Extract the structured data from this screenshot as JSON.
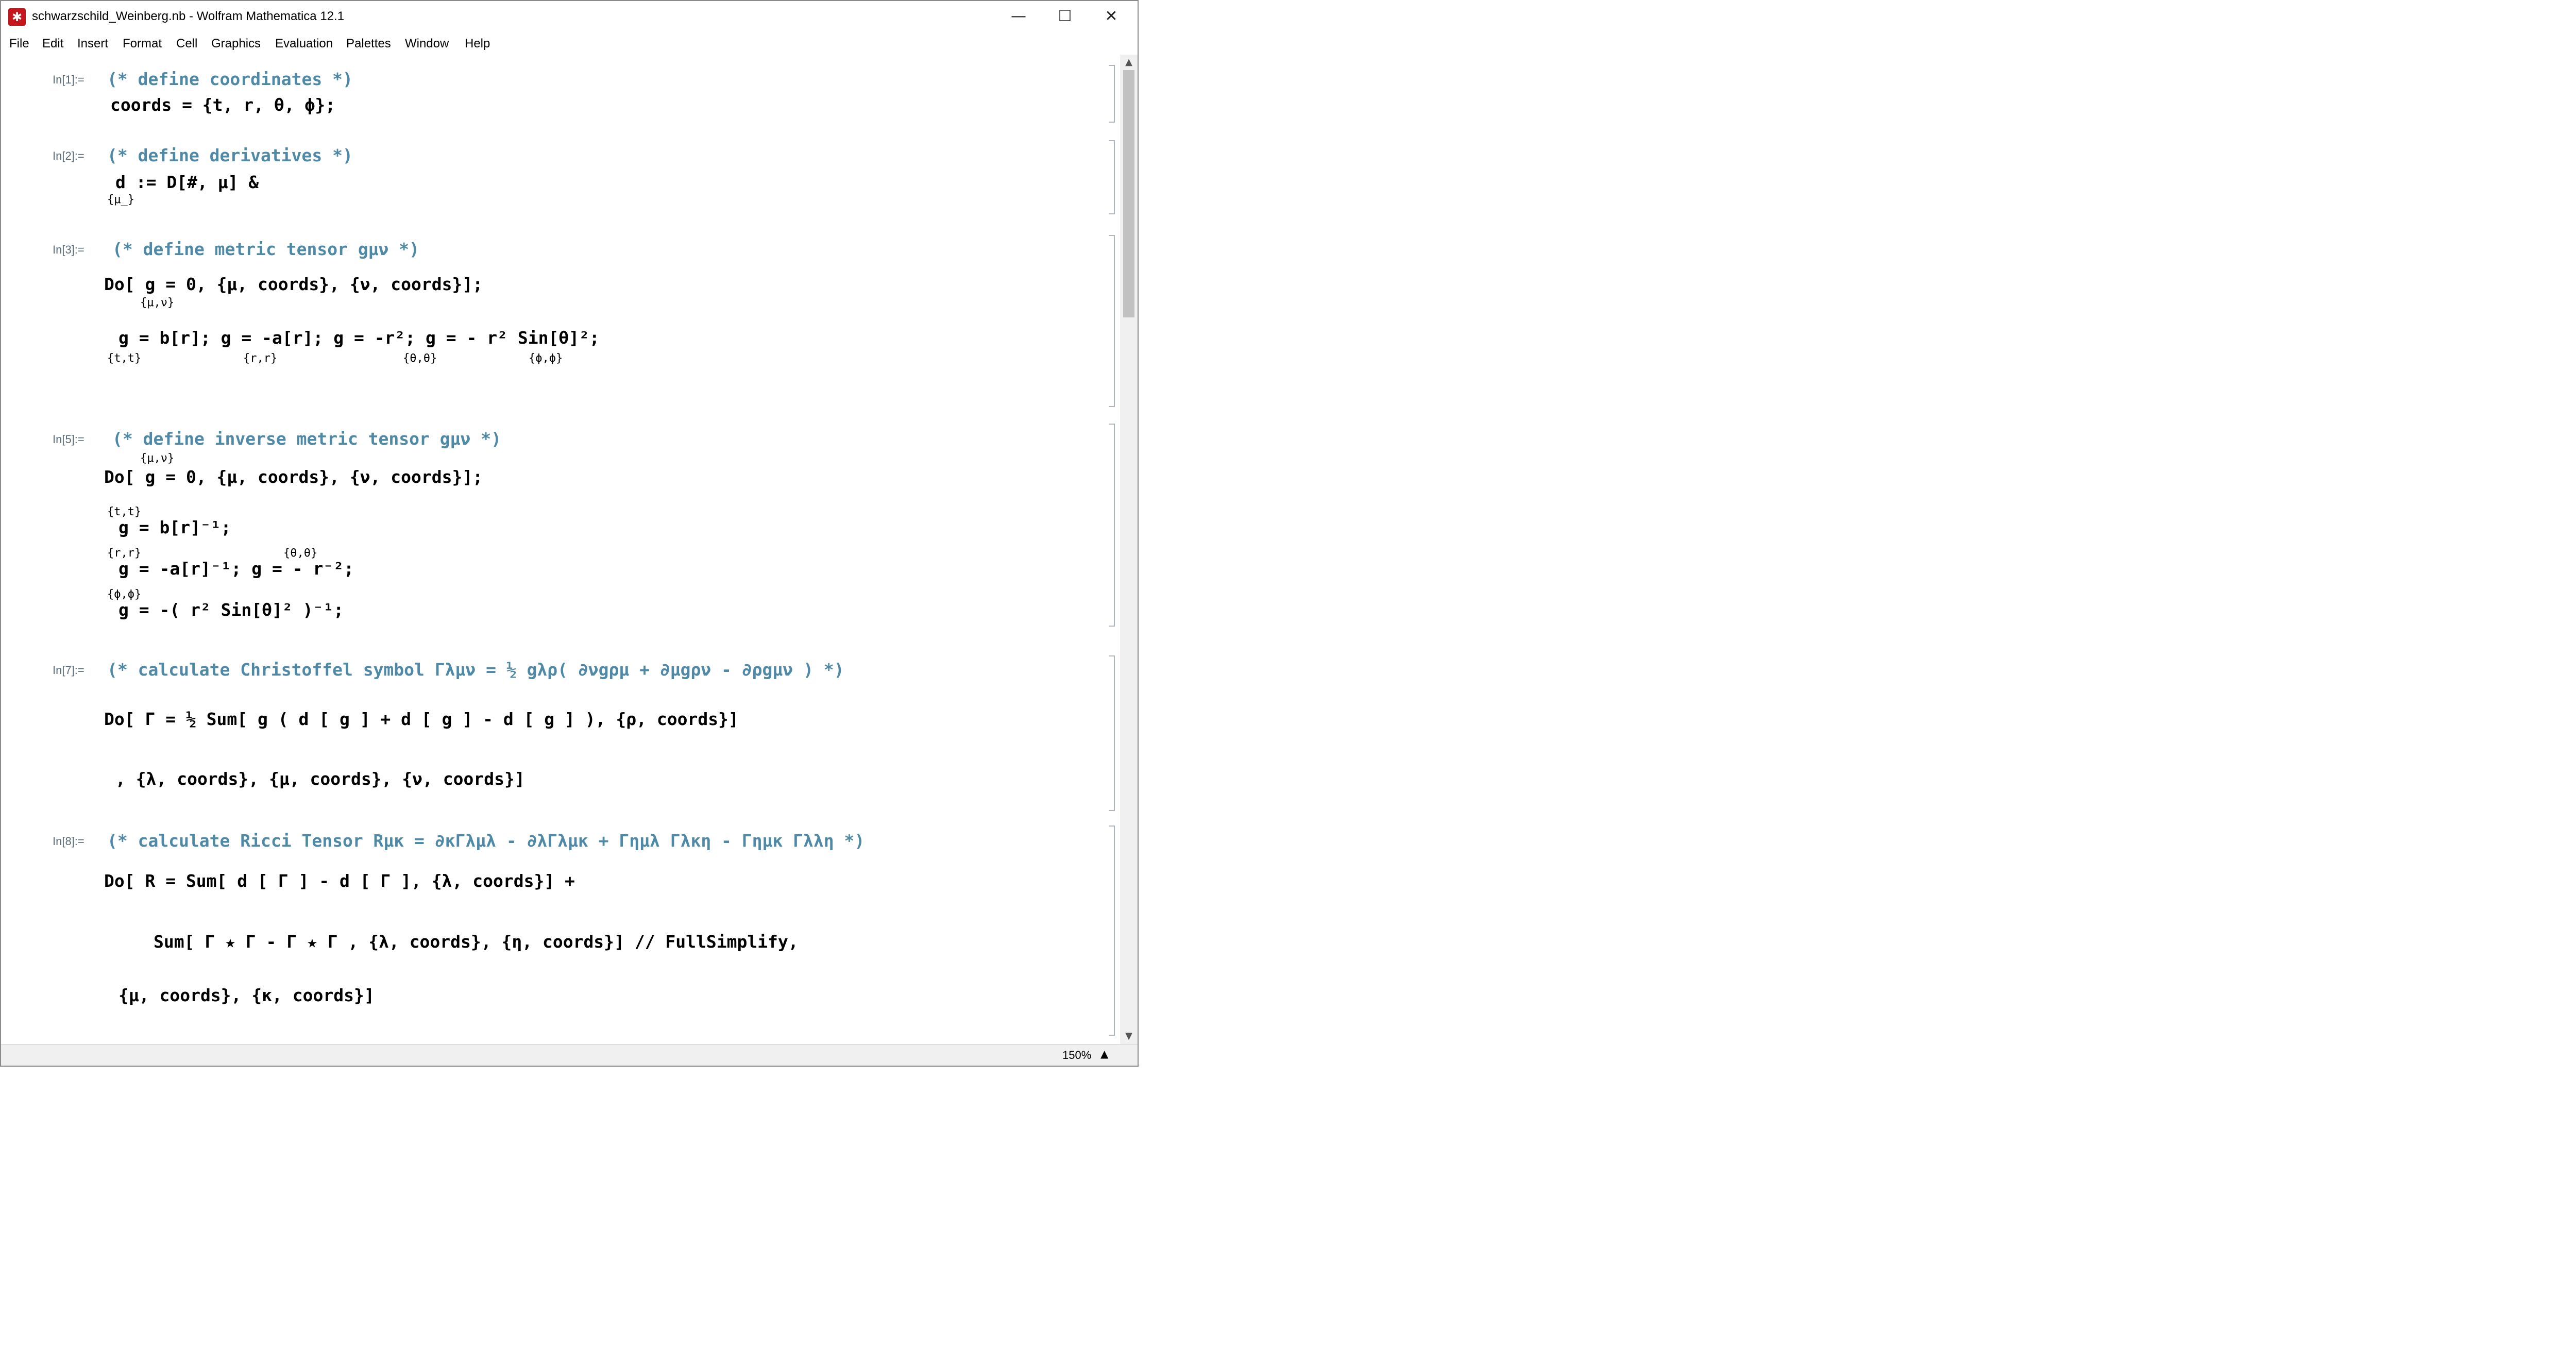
{
  "window": {
    "title": "schwarzschild_Weinberg.nb - Wolfram Mathematica 12.1",
    "app_icon": "mathematica-icon",
    "minimize": "—",
    "maximize": "☐",
    "close": "✕"
  },
  "menu": [
    "File",
    "Edit",
    "Insert",
    "Format",
    "Cell",
    "Graphics",
    "Evaluation",
    "Palettes",
    "Window",
    "Help"
  ],
  "cells": [
    {
      "label": "In[1]:=",
      "comment": "(* define coordinates *)",
      "lines": [
        "coords = {t, r, θ, ϕ};"
      ]
    },
    {
      "label": "In[2]:=",
      "comment": "(* define derivatives *)",
      "lines": [
        "d   := D[#, μ] &"
      ],
      "subs": [
        "{μ_}"
      ]
    },
    {
      "label": "In[3]:=",
      "comment": "(* define metric tensor gμν  *)",
      "lines": [
        "Do[ g    = 0, {μ, coords}, {ν, coords}];",
        "g      = b[r];  g      = -a[r];  g      = -r²;  g      = - r² Sin[θ]²;"
      ],
      "subs": [
        "{μ,ν}",
        "{t,t}",
        "{r,r}",
        "{θ,θ}",
        "{ϕ,ϕ}"
      ]
    },
    {
      "label": "In[5]:=",
      "comment": "(* define inverse metric tensor gμν  *)",
      "lines": [
        "Do[ g    = 0, {μ, coords}, {ν, coords}];",
        "g  = b[r]⁻¹;",
        "g   = -a[r]⁻¹;   g   = - r⁻²;",
        "g  = -( r² Sin[θ]² )⁻¹;"
      ],
      "sups": [
        "{μ,ν}",
        "{t,t}",
        "{r,r}",
        "{θ,θ}",
        "{ϕ,ϕ}"
      ]
    },
    {
      "label": "In[7]:=",
      "comment": "(* calculate Christoffel symbol  Γλμν =  ½  gλρ( ∂νgρμ + ∂μgρν - ∂ρgμν )  *)",
      "lines": [
        "Do[ Γ   =  ½ Sum[ g  ( d  [ g   ] + d  [ g   ] - d  [ g   ] ), {ρ, coords}]",
        ", {λ, coords}, {μ, coords}, {ν, coords}]"
      ],
      "frac_num": "1",
      "frac_den": "2"
    },
    {
      "label": "In[8]:=",
      "comment": "(* calculate Ricci Tensor  Rμκ = ∂κΓλμλ - ∂λΓλμκ  + Γημλ Γλκη -  Γημκ Γλλη  *)",
      "lines": [
        "Do[ R    = Sum[ d  [ Γ    ] - d  [ Γ    ], {λ, coords}] +",
        "Sum[ Γ    ★ Γ    - Γ    ★ Γ    , {λ, coords}, {η, coords}] // FullSimplify,",
        "{μ, coords}, {κ, coords}]"
      ]
    }
  ],
  "status": {
    "zoom": "150%"
  }
}
